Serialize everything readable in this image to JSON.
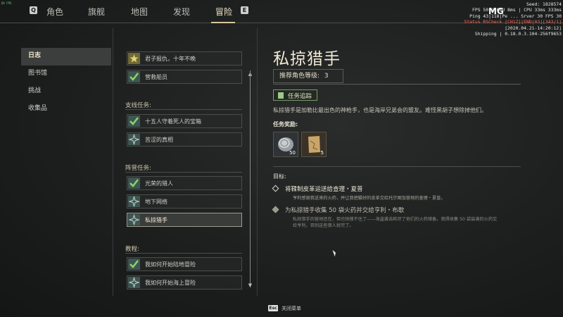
{
  "nav": {
    "key_left": "Q",
    "key_right": "E",
    "tabs": [
      "角色",
      "旗舰",
      "地图",
      "发现",
      "冒险"
    ],
    "active_tab": "冒险"
  },
  "debug": {
    "seed": "Seed: 1828574",
    "fps_line": "FPS 50 | GPU 8ms | CPU 33ms 333ms",
    "ping_line": "Ping 43|118|Pe ... Srver 30 FPS 30",
    "status_line": "Status  RSCheck [CH1Z][END|03][343/1]",
    "date_line": "[2020.04.21-14:20:12]",
    "build_line": "Shipping | 0.18.0.3.104-256f9653",
    "badge": "MG",
    "corner": "DX FPS"
  },
  "left_menu": {
    "items": [
      "日志",
      "图书馆",
      "挑战",
      "收集品"
    ],
    "active": "日志"
  },
  "quests": {
    "main": [
      {
        "label": "君子报仇，十年不晚",
        "icon": "gold-star-icon"
      },
      {
        "label": "营救船员",
        "icon": "check-icon"
      }
    ],
    "side_header": "支线任务:",
    "side": [
      {
        "label": "十五人守着死人的宝箱",
        "icon": "check-icon"
      },
      {
        "label": "苦涩的真相",
        "icon": "compass-star-icon"
      }
    ],
    "faction_header": "阵营任务:",
    "faction": [
      {
        "label": "光荣的猎人",
        "icon": "check-icon"
      },
      {
        "label": "地下网络",
        "icon": "compass-star-icon"
      },
      {
        "label": "私掠猎手",
        "icon": "compass-star-icon"
      }
    ],
    "tutorial_header": "教程:",
    "tutorial": [
      {
        "label": "我如何开始陆地冒险",
        "icon": "check-icon"
      },
      {
        "label": "我如何开始海上冒险",
        "icon": "compass-star-icon"
      }
    ],
    "selected": "私掠猎手"
  },
  "detail": {
    "title": "私掠猎手",
    "level_label": "推荐角色等级:",
    "level_value": "3",
    "track_label": "任务追踪",
    "description": "私掠猎手是加勒比最出色的神枪手，也是海岸兄弟会的盟友。难怪黑胡子想除掉他们。",
    "rewards_label": "任务奖励:",
    "rewards": [
      {
        "icon": "silver-coin-icon",
        "count": "50"
      },
      {
        "icon": "treasure-map-icon",
        "count": "5"
      }
    ],
    "goals_label": "目标:",
    "goals": [
      {
        "title": "将鞣制皮革运送给查理・夏普",
        "lines": [
          "亨利感谢我送来的火药，并让我把鞣好的皮革交给托尔图加营地的查理・夏普。"
        ]
      },
      {
        "title": "为私掠猎手收集 50 袋火药并交给亨利・布歇",
        "lines": [
          "私掠猎手的营地还在，但也快撑不住了——海盗袭击耗尽了他们的火药储备。我得收集 50 袋装满的火药交",
          "给亨利，否则这些猎人就完了。"
        ]
      }
    ]
  },
  "footer": {
    "key": "Esc",
    "label": "关闭菜单"
  },
  "colors": {
    "accent_gold": "#d8c89a",
    "check_green": "#8fd16a",
    "track_green": "#9ec98a"
  }
}
